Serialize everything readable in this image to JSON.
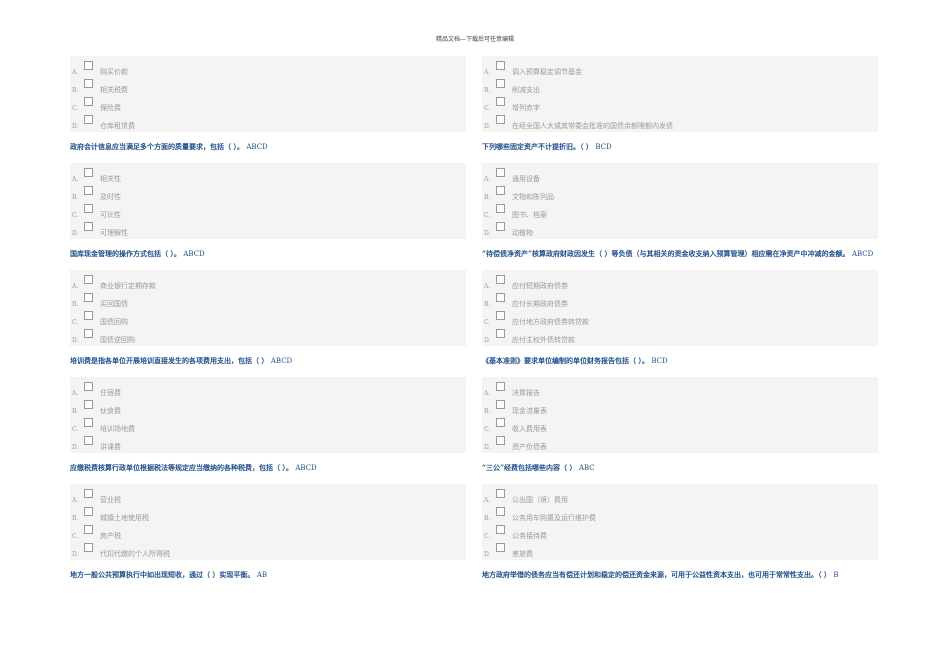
{
  "header": "精品文档---下载后可任意编辑",
  "left": [
    {
      "question": "",
      "answer": "",
      "options": [
        {
          "letter": "A.",
          "text": "购买价款"
        },
        {
          "letter": "B.",
          "text": "相关税费"
        },
        {
          "letter": "C.",
          "text": "保险费"
        },
        {
          "letter": "D.",
          "text": "仓库租赁费"
        }
      ]
    },
    {
      "question": "政府会计信息应当满足多个方面的质量要求，包括（ ）。",
      "answer": "ABCD",
      "options": [
        {
          "letter": "A.",
          "text": "相关性"
        },
        {
          "letter": "B.",
          "text": "及时性"
        },
        {
          "letter": "C.",
          "text": "可比性"
        },
        {
          "letter": "D.",
          "text": "可理解性"
        }
      ]
    },
    {
      "question": "国库现金管理的操作方式包括（ ）。",
      "answer": "ABCD",
      "options": [
        {
          "letter": "A.",
          "text": "商业银行定期存款"
        },
        {
          "letter": "B.",
          "text": "买回国债"
        },
        {
          "letter": "C.",
          "text": "国债回购"
        },
        {
          "letter": "D.",
          "text": "国债逆回购"
        }
      ]
    },
    {
      "question": "培训费是指各单位开展培训直接发生的各项费用支出，包括（ ）",
      "answer": "ABCD",
      "options": [
        {
          "letter": "A.",
          "text": "住宿费"
        },
        {
          "letter": "B.",
          "text": "伙食费"
        },
        {
          "letter": "C.",
          "text": "培训场地费"
        },
        {
          "letter": "D.",
          "text": "讲课费"
        }
      ]
    },
    {
      "question": "应缴税费核算行政单位根据税法等规定应当缴纳的各种税费，包括（ ）。",
      "answer": "ABCD",
      "options": [
        {
          "letter": "A.",
          "text": "营业税"
        },
        {
          "letter": "B.",
          "text": "城镇土地使用税"
        },
        {
          "letter": "C.",
          "text": "房产税"
        },
        {
          "letter": "D.",
          "text": "代扣代缴的个人所得税"
        }
      ]
    },
    {
      "question": "地方一般公共预算执行中如出现短收，通过（ ）实现平衡。",
      "answer": "AB",
      "options": []
    }
  ],
  "right": [
    {
      "question": "",
      "answer": "",
      "options": [
        {
          "letter": "A.",
          "text": "调入预算稳定调节基金"
        },
        {
          "letter": "B.",
          "text": "削减支出"
        },
        {
          "letter": "C.",
          "text": "增列赤字"
        },
        {
          "letter": "D.",
          "text": "在经全国人大或其常委会批准的国债余额限额内发债"
        }
      ]
    },
    {
      "question": "下列哪些固定资产不计提折旧。（ ）",
      "answer": "BCD",
      "options": [
        {
          "letter": "A.",
          "text": "通用设备"
        },
        {
          "letter": "B.",
          "text": "文物和陈列品"
        },
        {
          "letter": "C.",
          "text": "图书、档案"
        },
        {
          "letter": "D.",
          "text": "动植物"
        }
      ]
    },
    {
      "question": "“待偿债净资产”核算政府财政因发生（ ）等负债（与其相关的资金收支纳入预算管理）相应需在净资产中冲减的金额。",
      "answer": "ABCD",
      "options": [
        {
          "letter": "A.",
          "text": "应付短期政府债券"
        },
        {
          "letter": "B.",
          "text": "应付长期政府债券"
        },
        {
          "letter": "C.",
          "text": "应付地方政府债券转贷款"
        },
        {
          "letter": "D.",
          "text": "应付主权外债转贷款"
        }
      ]
    },
    {
      "question": "《基本准则》要求单位编制的单位财务报告包括（ ）。",
      "answer": "BCD",
      "options": [
        {
          "letter": "A.",
          "text": "决算报告"
        },
        {
          "letter": "B.",
          "text": "现金流量表"
        },
        {
          "letter": "C.",
          "text": "收入费用表"
        },
        {
          "letter": "D.",
          "text": "资产负债表"
        }
      ]
    },
    {
      "question": "“三公”经费包括哪些内容（ ）",
      "answer": "ABC",
      "options": [
        {
          "letter": "A.",
          "text": "公出国（境）费用"
        },
        {
          "letter": "B.",
          "text": "公务用车购置及运行维护费"
        },
        {
          "letter": "C.",
          "text": "公务接待费"
        },
        {
          "letter": "D.",
          "text": "差旅费"
        }
      ]
    },
    {
      "question": "地方政府举借的债务应当有偿还计划和稳定的偿还资金来源，可用于公益性资本支出，也可用于常常性支出。（ ）",
      "answer": "B",
      "options": []
    }
  ]
}
